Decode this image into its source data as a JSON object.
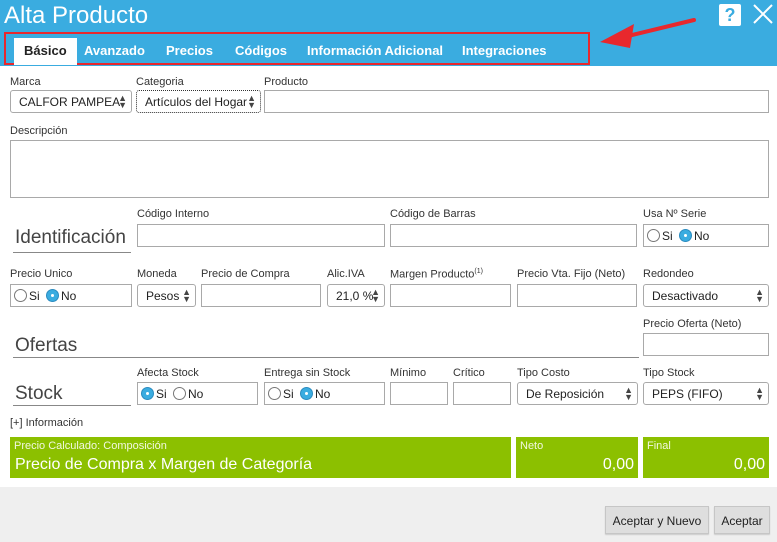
{
  "dialog": {
    "title": "Alta Producto"
  },
  "tabs": [
    {
      "label": "Básico"
    },
    {
      "label": "Avanzado"
    },
    {
      "label": "Precios"
    },
    {
      "label": "Códigos"
    },
    {
      "label": "Información Adicional"
    },
    {
      "label": "Integraciones"
    }
  ],
  "fields": {
    "marca": {
      "label": "Marca",
      "value": "CALFOR PAMPEA"
    },
    "categoria": {
      "label": "Categoria",
      "value": "Artículos del Hogar"
    },
    "producto": {
      "label": "Producto",
      "value": ""
    },
    "descripcion": {
      "label": "Descripción",
      "value": ""
    },
    "codigo_interno": {
      "label": "Código Interno",
      "value": ""
    },
    "codigo_barras": {
      "label": "Código de Barras",
      "value": ""
    },
    "usa_serie": {
      "label": "Usa Nº Serie",
      "opt_si": "Si",
      "opt_no": "No",
      "selected": "No"
    },
    "precio_unico": {
      "label": "Precio Unico",
      "opt_si": "Si",
      "opt_no": "No",
      "selected": "No"
    },
    "moneda": {
      "label": "Moneda",
      "value": "Pesos"
    },
    "precio_compra": {
      "label": "Precio de Compra",
      "value": ""
    },
    "alic_iva": {
      "label": "Alic.IVA",
      "value": "21,0 %"
    },
    "margen": {
      "label": "Margen Producto",
      "sup": "(1)",
      "value": ""
    },
    "precio_vta_fijo": {
      "label": "Precio Vta. Fijo (Neto)",
      "value": ""
    },
    "redondeo": {
      "label": "Redondeo",
      "value": "Desactivado"
    },
    "precio_oferta": {
      "label": "Precio Oferta (Neto)",
      "value": ""
    },
    "afecta_stock": {
      "label": "Afecta Stock",
      "opt_si": "Si",
      "opt_no": "No",
      "selected": "Si"
    },
    "entrega_sin_stock": {
      "label": "Entrega sin Stock",
      "opt_si": "Si",
      "opt_no": "No",
      "selected": "No"
    },
    "minimo": {
      "label": "Mínimo",
      "value": ""
    },
    "critico": {
      "label": "Crítico",
      "value": ""
    },
    "tipo_costo": {
      "label": "Tipo Costo",
      "value": "De Reposición"
    },
    "tipo_stock": {
      "label": "Tipo Stock",
      "value": "PEPS (FIFO)"
    }
  },
  "sections": {
    "identificacion": "Identificación",
    "ofertas": "Ofertas",
    "stock": "Stock"
  },
  "info_link": "[+] Información",
  "summary": {
    "composicion_label": "Precio Calculado: Composición",
    "composicion_value": "Precio de Compra x Margen de Categoría",
    "neto_label": "Neto",
    "neto_value": "0,00",
    "final_label": "Final",
    "final_value": "0,00"
  },
  "buttons": {
    "aceptar_nuevo": "Aceptar y Nuevo",
    "aceptar": "Aceptar"
  },
  "colors": {
    "header": "#3aace0",
    "highlight": "#e8282d",
    "summary": "#8cc000"
  },
  "icons": [
    "help-icon",
    "close-icon",
    "arrow-annotation-icon"
  ]
}
